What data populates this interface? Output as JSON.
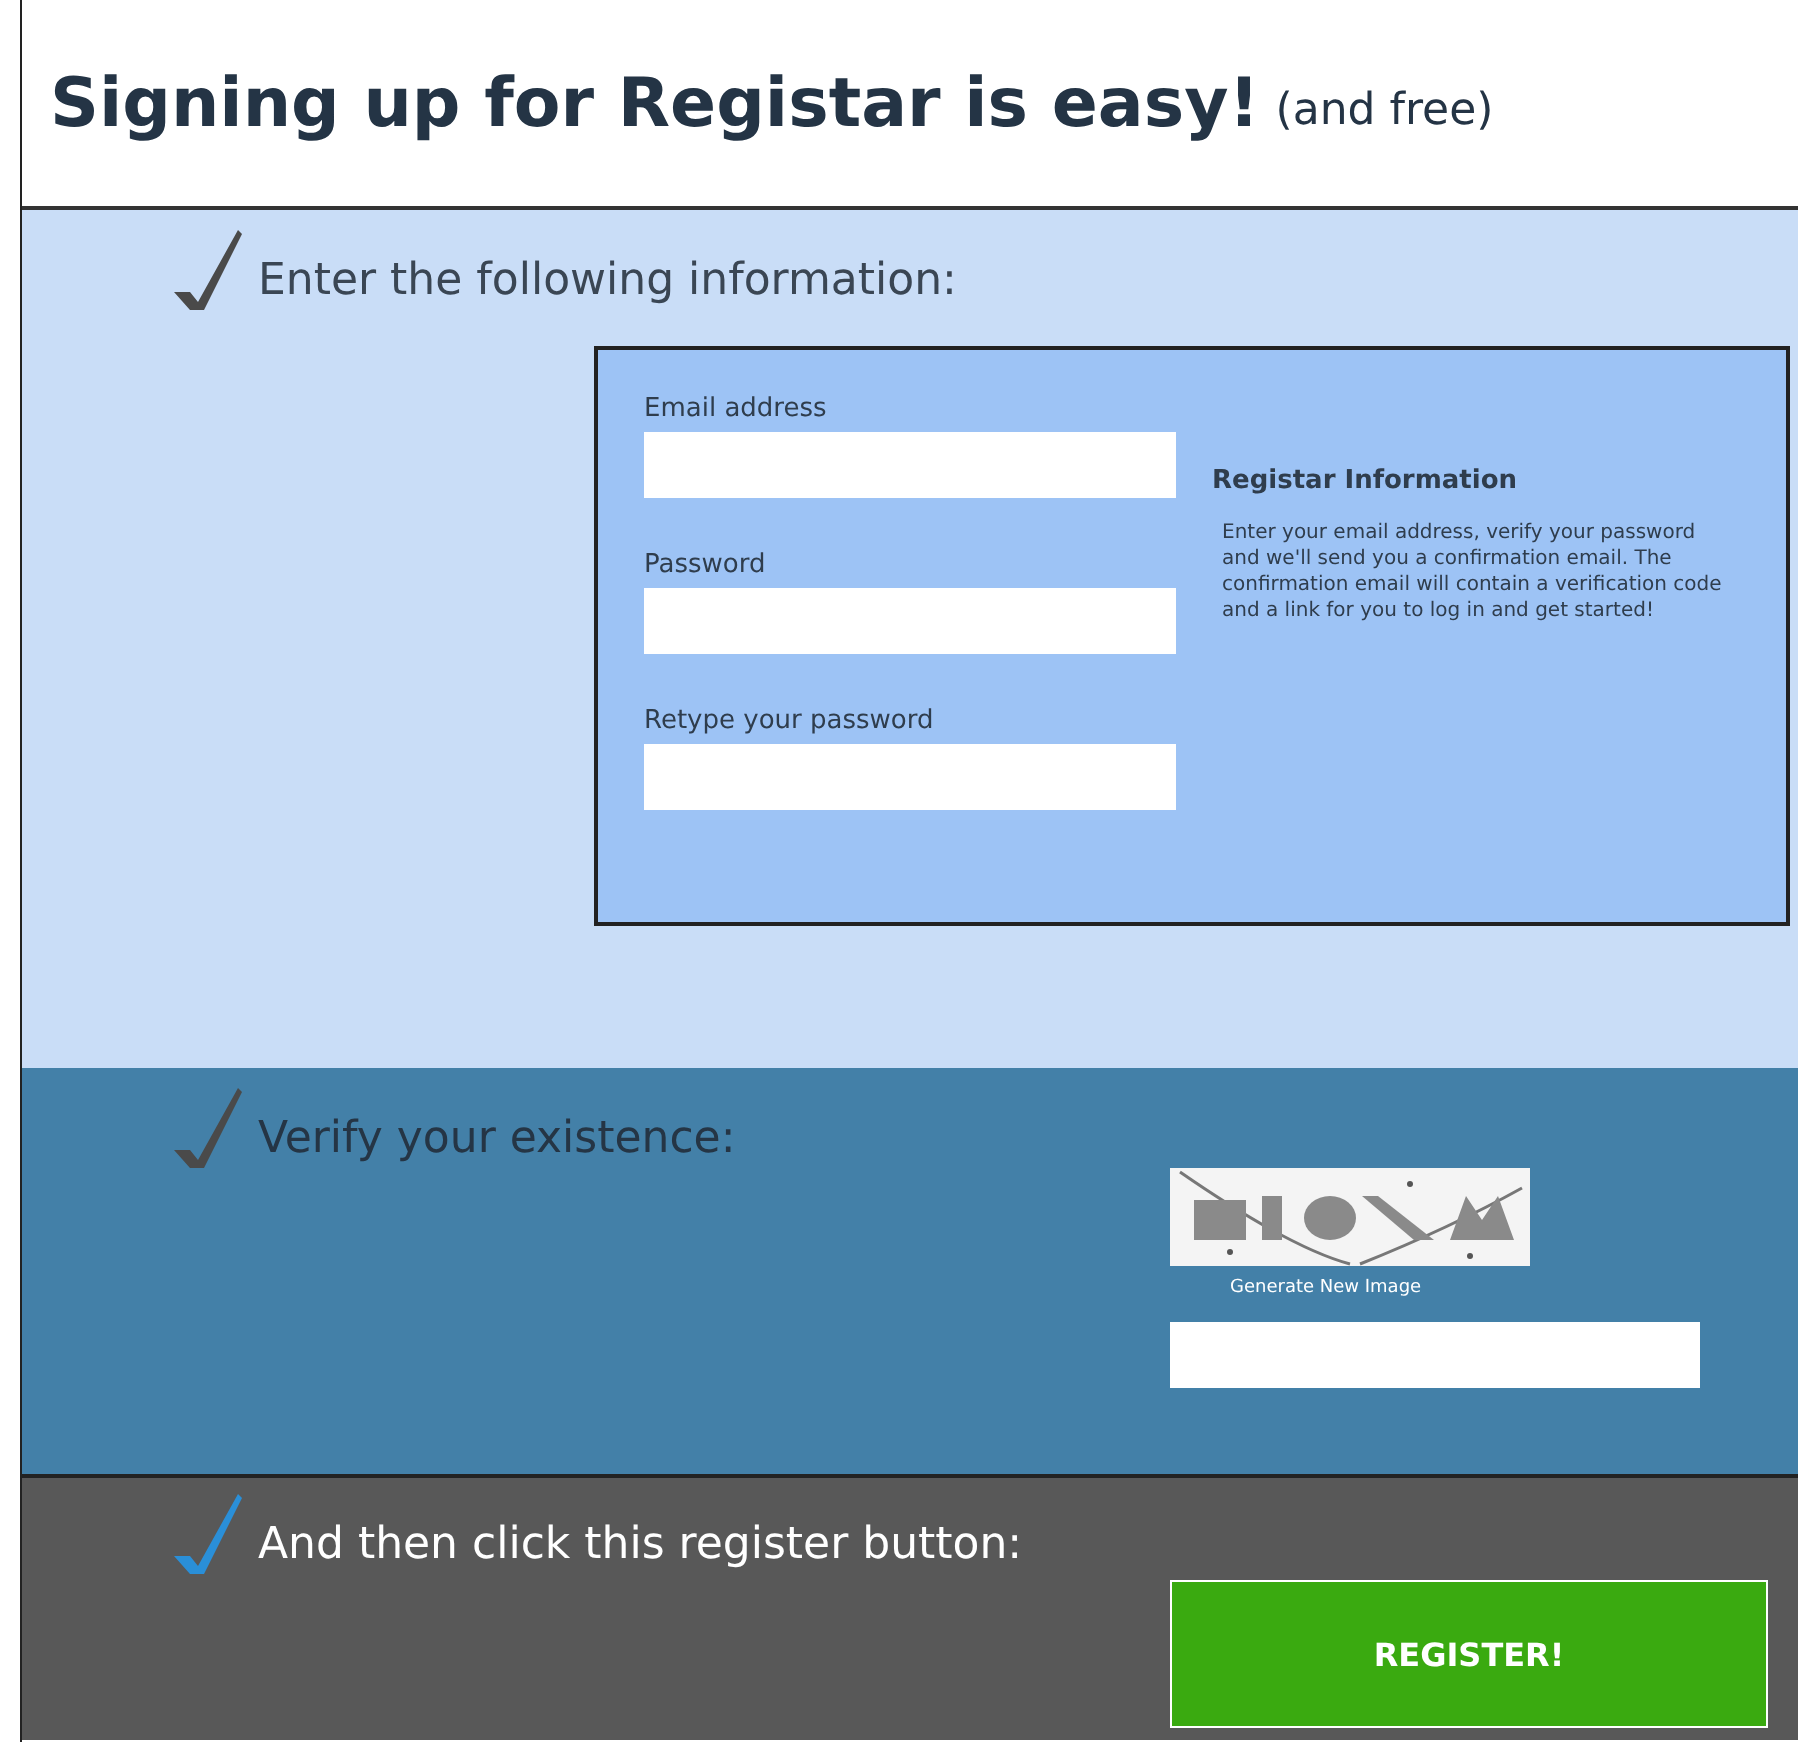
{
  "header": {
    "title": "Signing up for Registar is easy!",
    "subtitle": "(and free)"
  },
  "steps": [
    {
      "kind": "form",
      "heading": "Enter the following information:",
      "color": "#4a4a4a",
      "fields": [
        {
          "label": "Email address"
        },
        {
          "label": "Password"
        },
        {
          "label": "Retype your password"
        }
      ],
      "info": {
        "title": "Registar Information",
        "body": "Enter your email address, verify your password and we'll send you a confirmation email. The confirmation email will contain a verification code and a link for you to log in and get started!"
      }
    },
    {
      "kind": "captcha",
      "heading": "Verify your existence:",
      "color": "#4a4a4a",
      "link": "Generate New Image"
    },
    {
      "kind": "submit",
      "heading": "And then click this register button:",
      "color": "#2a8fd8",
      "button": "REGISTER!"
    }
  ]
}
